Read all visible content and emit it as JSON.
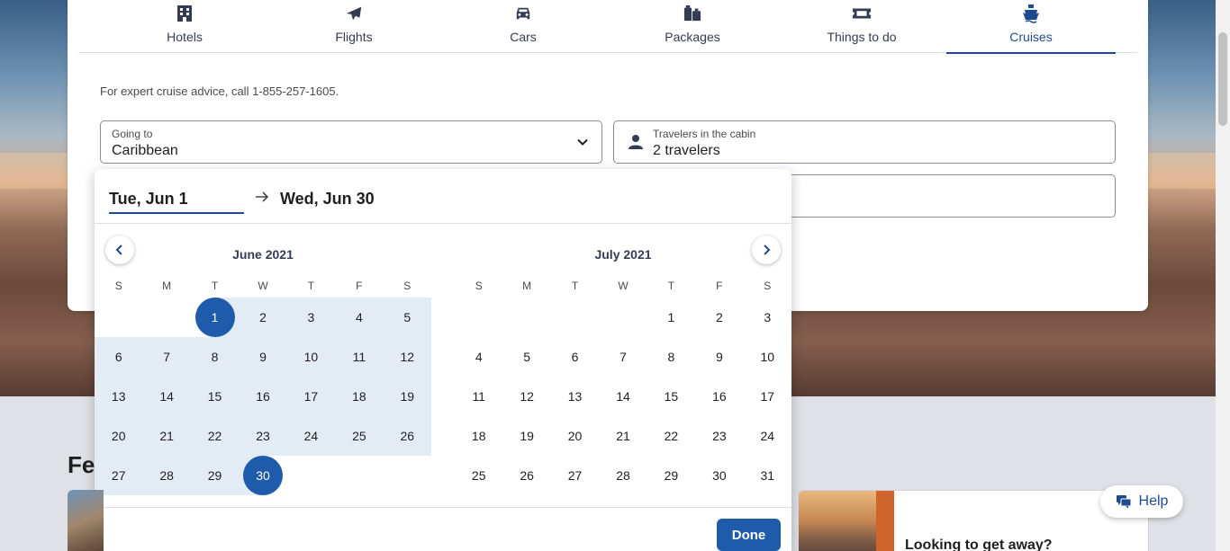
{
  "tabs": [
    {
      "label": "Hotels",
      "icon": "building-icon"
    },
    {
      "label": "Flights",
      "icon": "plane-icon"
    },
    {
      "label": "Cars",
      "icon": "car-icon"
    },
    {
      "label": "Packages",
      "icon": "luggage-icon"
    },
    {
      "label": "Things to do",
      "icon": "ticket-icon"
    },
    {
      "label": "Cruises",
      "icon": "ship-icon",
      "active": true
    }
  ],
  "advice_text": "For expert cruise advice, call 1-855-257-1605.",
  "going_to": {
    "label": "Going to",
    "value": "Caribbean"
  },
  "travelers": {
    "label": "Travelers in the cabin",
    "value": "2 travelers"
  },
  "datepicker": {
    "start": "Tue, Jun 1",
    "end": "Wed, Jun 30",
    "weekday_headers": [
      "S",
      "M",
      "T",
      "W",
      "T",
      "F",
      "S"
    ],
    "month1": {
      "title": "June 2021",
      "first_weekday": 2,
      "days": 30
    },
    "month2": {
      "title": "July 2021",
      "first_weekday": 4,
      "days": 31
    },
    "selected_start_day": 1,
    "selected_end_day": 30,
    "done_label": "Done"
  },
  "section_heading_partial": "Fe",
  "promo_title": "Looking to get away?",
  "help_label": "Help",
  "colors": {
    "accent": "#1e5bab",
    "range": "#e3ebf5",
    "tab_active": "#1e4b8f"
  }
}
